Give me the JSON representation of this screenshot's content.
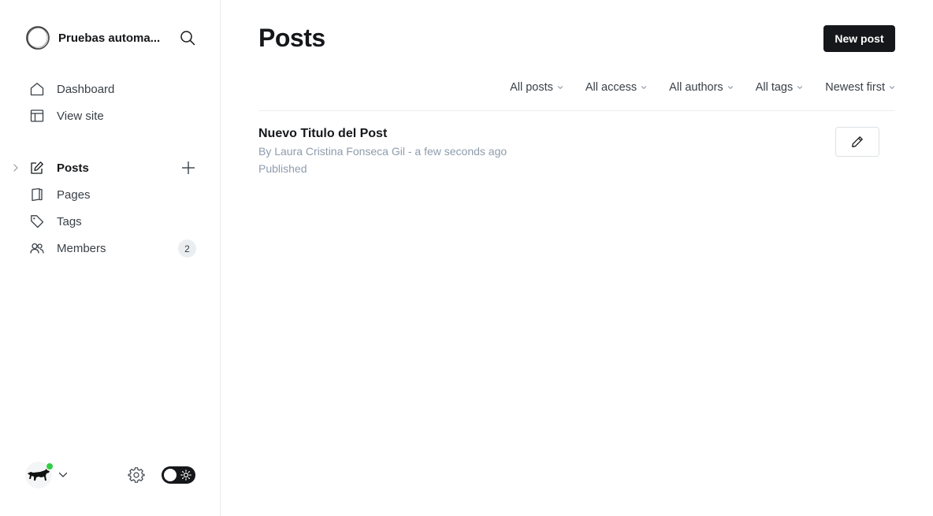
{
  "site": {
    "title": "Pruebas automa...",
    "logo_icon": "circle-logo-icon",
    "search_icon": "search-icon"
  },
  "nav": {
    "dashboard": "Dashboard",
    "view_site": "View site",
    "posts": "Posts",
    "pages": "Pages",
    "tags": "Tags",
    "members": "Members",
    "members_count": "2"
  },
  "main": {
    "title": "Posts",
    "new_post_label": "New post",
    "filters": {
      "type": "All posts",
      "access": "All access",
      "authors": "All authors",
      "tags": "All tags",
      "order": "Newest first"
    }
  },
  "posts": [
    {
      "title": "Nuevo Titulo del Post",
      "meta": "By Laura Cristina Fonseca Gil - a few seconds ago",
      "status": "Published"
    }
  ],
  "colors": {
    "accent": "#15171a",
    "status_online": "#30cf43",
    "muted_text": "#8e9cac"
  }
}
